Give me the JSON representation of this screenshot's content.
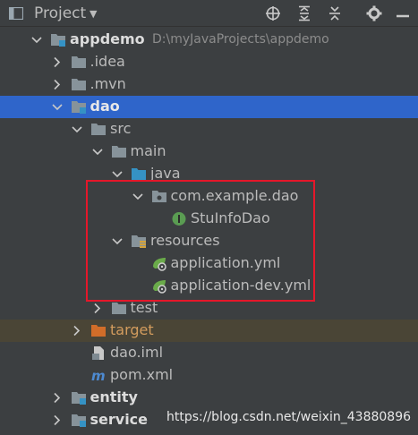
{
  "header": {
    "title": "Project",
    "tools": [
      "locate-icon",
      "expand-all-icon",
      "collapse-all-icon",
      "settings-icon",
      "hide-icon"
    ]
  },
  "tree": [
    {
      "label": "appdemo",
      "path": "D:\\myJavaProjects\\appdemo",
      "icon": "module-folder-icon",
      "arrow": "down",
      "level": 0,
      "bold": true
    },
    {
      "label": ".idea",
      "icon": "folder-icon",
      "arrow": "right",
      "level": 1
    },
    {
      "label": ".mvn",
      "icon": "folder-icon",
      "arrow": "right",
      "level": 1
    },
    {
      "label": "dao",
      "icon": "module-folder-icon",
      "arrow": "down",
      "level": 1,
      "bold": true,
      "selected": true
    },
    {
      "label": "src",
      "icon": "folder-icon",
      "arrow": "down",
      "level": 2
    },
    {
      "label": "main",
      "icon": "folder-icon",
      "arrow": "down",
      "level": 3
    },
    {
      "label": "java",
      "icon": "source-folder-icon",
      "arrow": "down",
      "level": 4
    },
    {
      "label": "com.example.dao",
      "icon": "package-icon",
      "arrow": "down",
      "level": 5
    },
    {
      "label": "StuInfoDao",
      "icon": "interface-icon",
      "arrow": "",
      "level": 6
    },
    {
      "label": "resources",
      "icon": "resources-folder-icon",
      "arrow": "down",
      "level": 4
    },
    {
      "label": "application.yml",
      "icon": "spring-config-icon",
      "arrow": "",
      "level": 5
    },
    {
      "label": "application-dev.yml",
      "icon": "spring-config-icon",
      "arrow": "",
      "level": 5
    },
    {
      "label": "test",
      "icon": "folder-icon",
      "arrow": "right",
      "level": 3
    },
    {
      "label": "target",
      "icon": "excluded-folder-icon",
      "arrow": "right",
      "level": 2,
      "dim": true
    },
    {
      "label": "dao.iml",
      "icon": "iml-file-icon",
      "arrow": "",
      "level": 2
    },
    {
      "label": "pom.xml",
      "icon": "maven-icon",
      "arrow": "",
      "level": 2
    },
    {
      "label": "entity",
      "icon": "module-folder-icon",
      "arrow": "right",
      "level": 1,
      "bold": true
    },
    {
      "label": "service",
      "icon": "module-folder-icon",
      "arrow": "right",
      "level": 1,
      "bold": true
    }
  ],
  "watermark": "https://blog.csdn.net/weixin_43880896",
  "colors": {
    "selection": "#2f65ca",
    "highlight_box": "#e5172a",
    "background": "#3c3f41"
  }
}
